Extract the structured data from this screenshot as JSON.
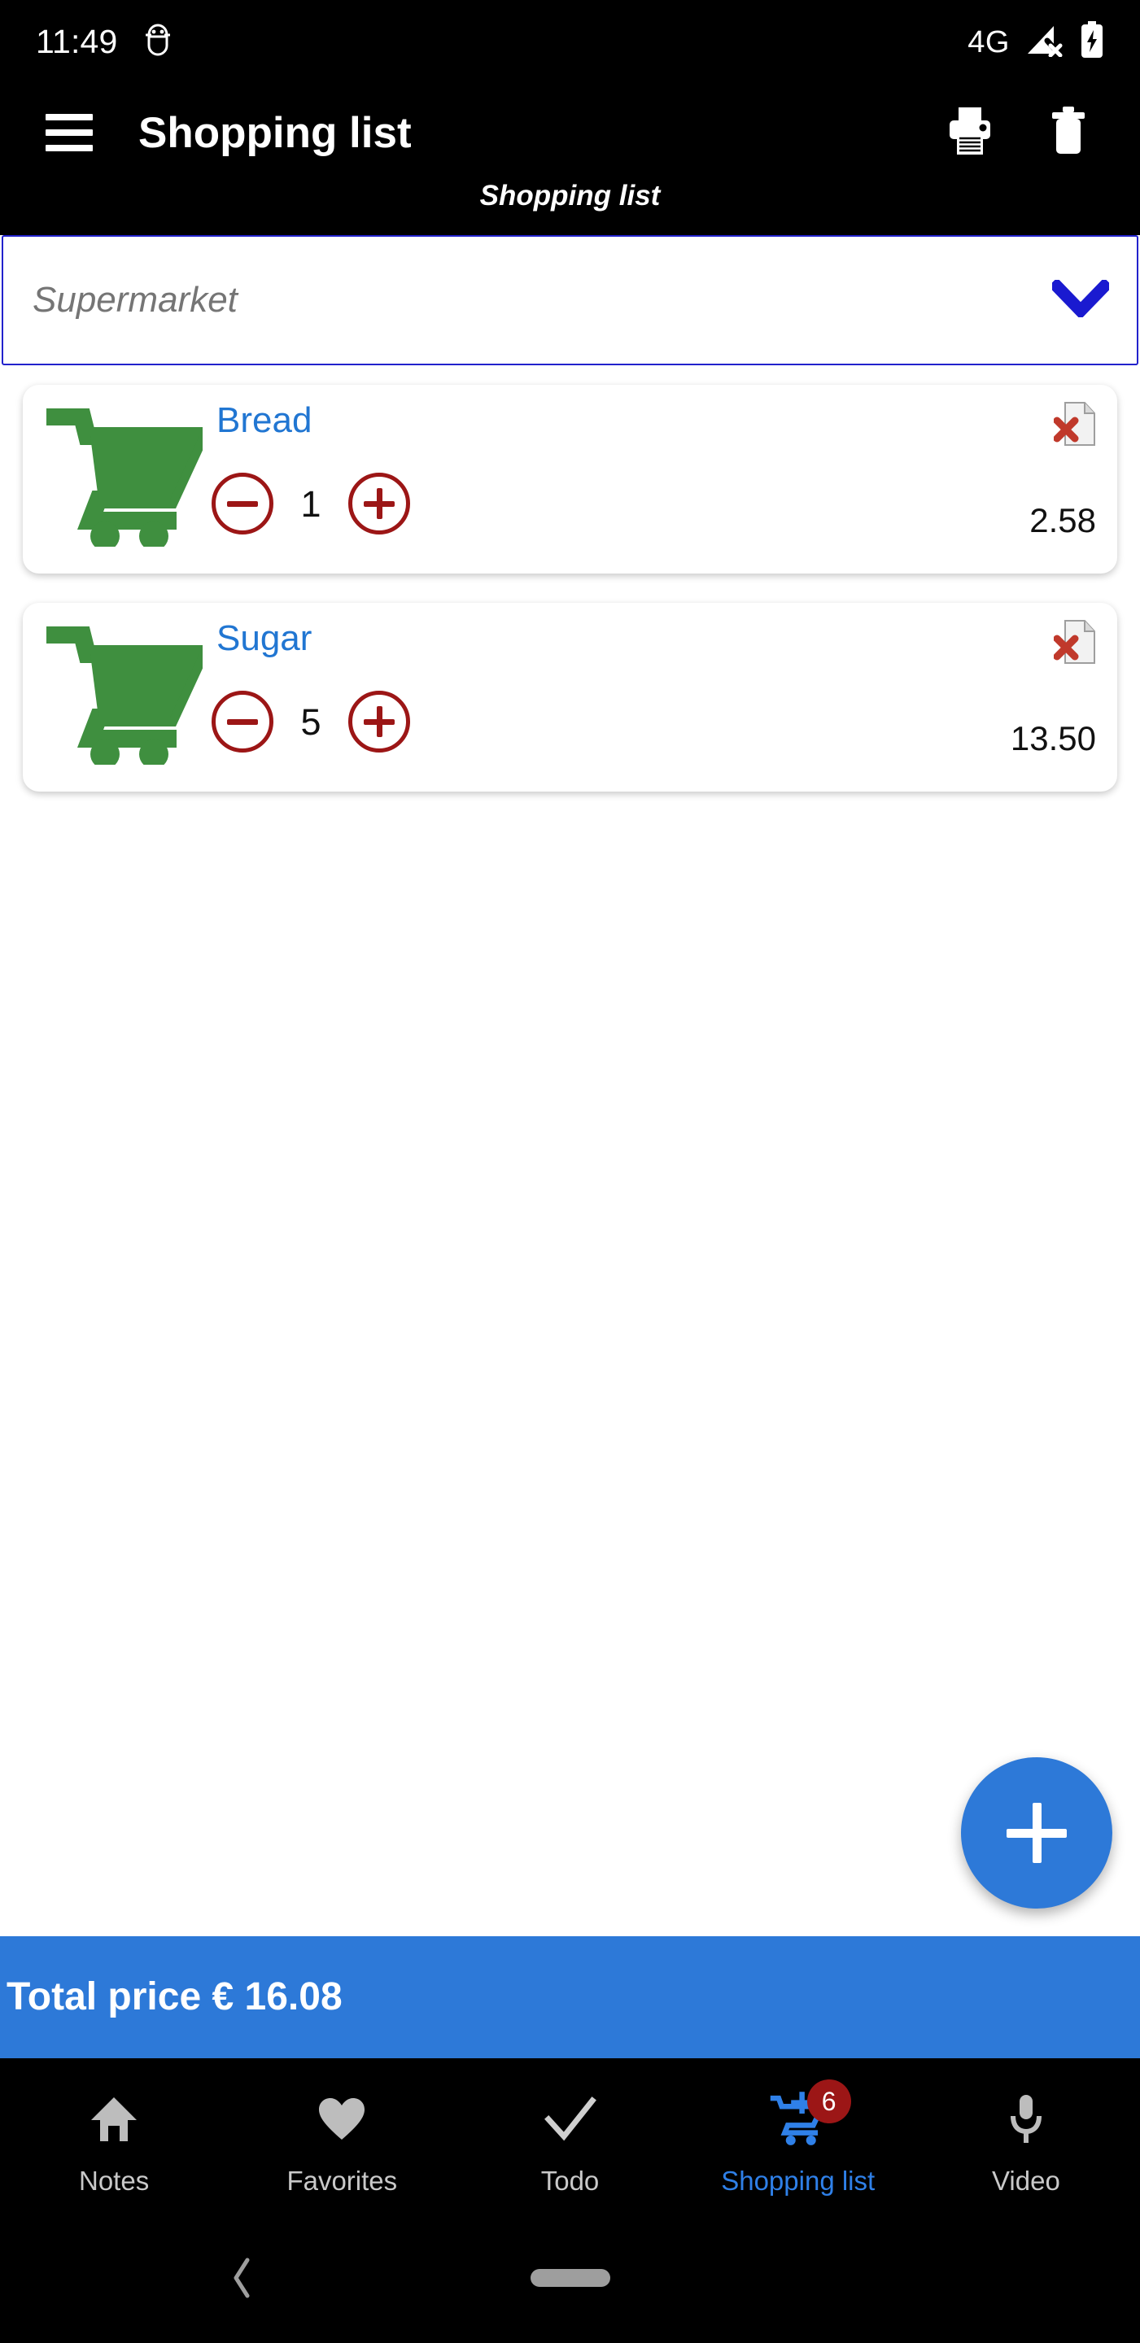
{
  "status_bar": {
    "time": "11:49",
    "debug_icon": "android-bug-icon",
    "network_label": "4G",
    "signal_icon": "signal-no-connection-icon",
    "battery_icon": "battery-charging-icon"
  },
  "app_bar": {
    "menu_icon": "hamburger-menu-icon",
    "title": "Shopping list",
    "print_icon": "printer-icon",
    "delete_icon": "trash-icon"
  },
  "subtitle": "Shopping list",
  "dropdown": {
    "selected": "Supermarket",
    "chevron_icon": "chevron-down-icon",
    "border_color": "#2222cc",
    "chevron_color": "#1a1ad0"
  },
  "items": [
    {
      "icon": "shopping-cart-icon",
      "name": "Bread",
      "quantity": "1",
      "price": "2.58",
      "minus_label": "−",
      "plus_label": "+",
      "remove_icon": "delete-document-icon"
    },
    {
      "icon": "shopping-cart-icon",
      "name": "Sugar",
      "quantity": "5",
      "price": "13.50",
      "minus_label": "−",
      "plus_label": "+",
      "remove_icon": "delete-document-icon"
    }
  ],
  "fab": {
    "icon": "plus-icon",
    "label": "+",
    "color": "#2d79d8"
  },
  "total": {
    "text": "Total price € 16.08",
    "background": "#2d79d8"
  },
  "bottom_nav": {
    "items": [
      {
        "label": "Notes",
        "icon": "home-icon",
        "active": false,
        "badge": ""
      },
      {
        "label": "Favorites",
        "icon": "heart-icon",
        "active": false,
        "badge": ""
      },
      {
        "label": "Todo",
        "icon": "check-icon",
        "active": false,
        "badge": ""
      },
      {
        "label": "Shopping list",
        "icon": "add-shopping-cart-icon",
        "active": true,
        "badge": "6"
      },
      {
        "label": "Video",
        "icon": "microphone-icon",
        "active": false,
        "badge": ""
      }
    ],
    "active_color": "#2f80e8",
    "badge_color": "#9c1616"
  },
  "system_nav": {
    "back_icon": "back-chevron-icon",
    "home_icon": "home-pill-icon"
  },
  "theme": {
    "item_name_color": "#2176d2",
    "cart_green": "#3f8f3f",
    "qty_red": "#9c1616",
    "bar_black": "#000000"
  }
}
